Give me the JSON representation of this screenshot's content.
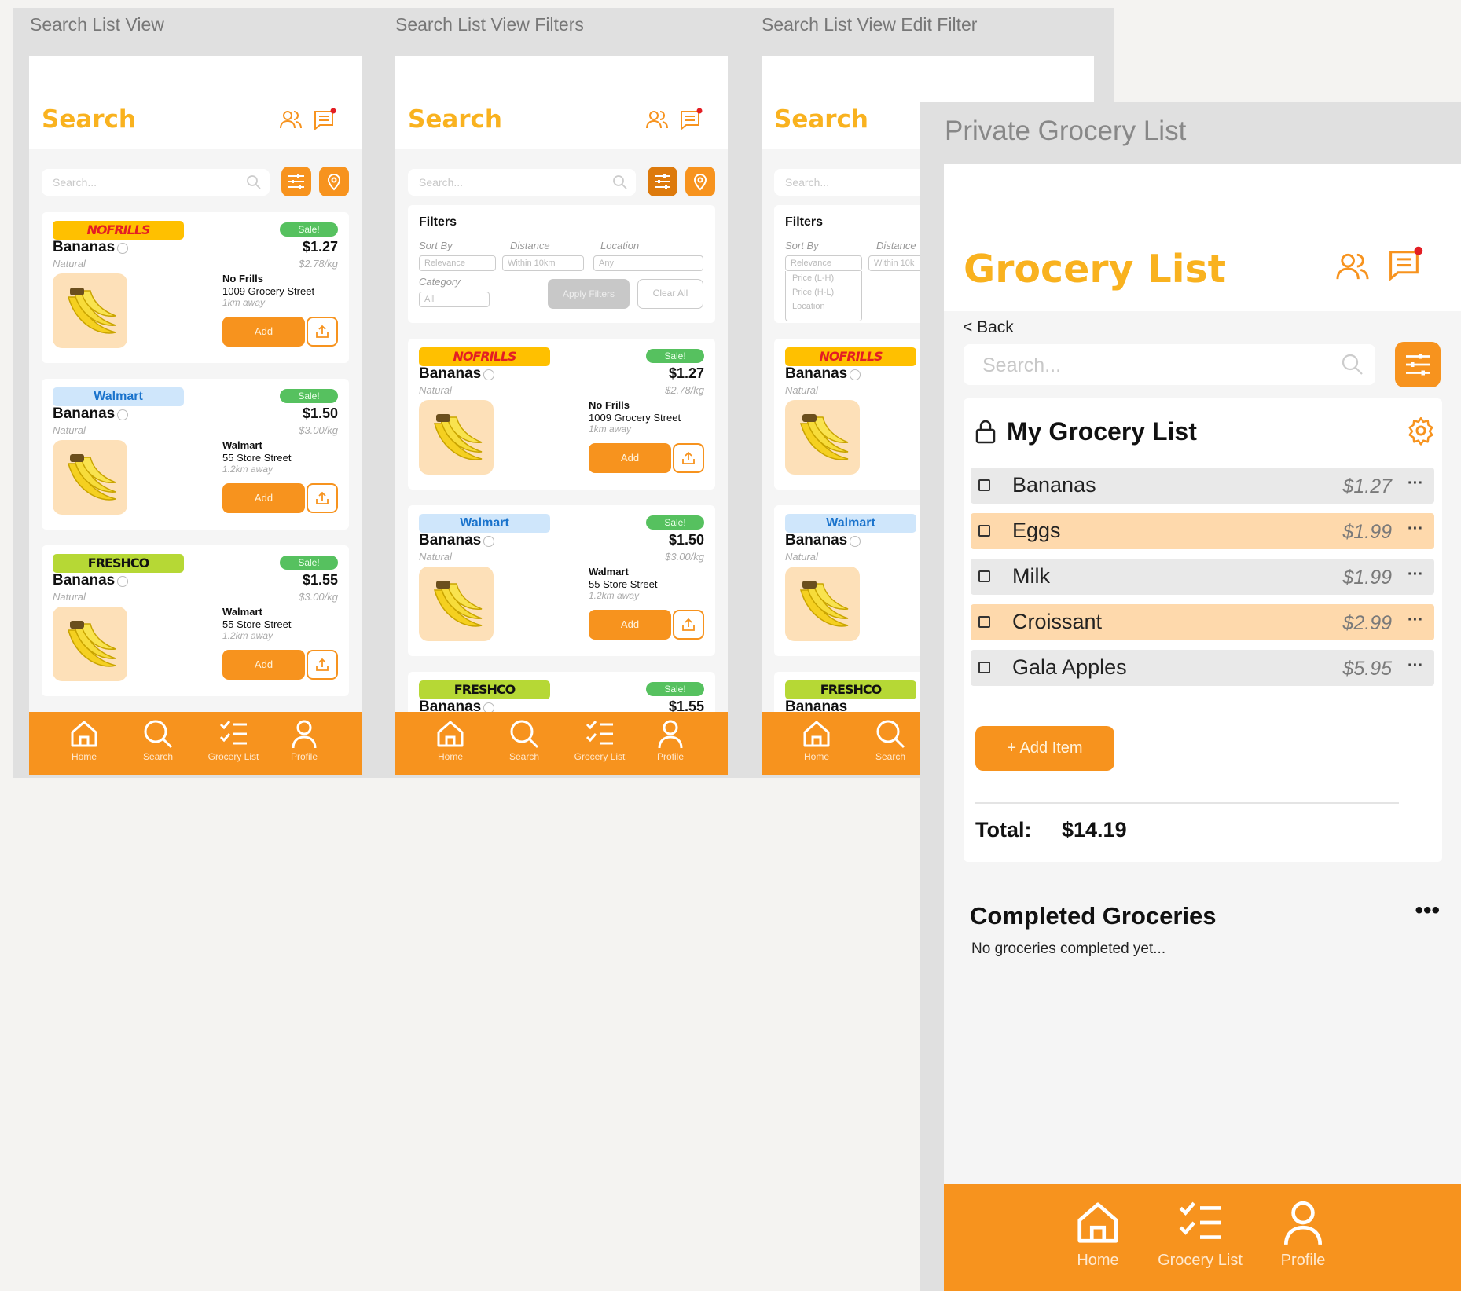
{
  "frames": {
    "list_view": "Search List View",
    "filters_view": "Search List View Filters",
    "edit_filter_view": "Search List View Edit Filter",
    "private_list": "Private Grocery List"
  },
  "search_screen": {
    "title": "Search",
    "search_placeholder": "Search...",
    "nav": [
      "Home",
      "Search",
      "Grocery List",
      "Profile"
    ]
  },
  "products": [
    {
      "logo": "NOFRILLS",
      "badge": "Sale!",
      "name": "Bananas",
      "variety": "Natural",
      "price": "$1.27",
      "unit_price": "$2.78/kg",
      "store": "No Frills",
      "address": "1009 Grocery Street",
      "distance": "1km away",
      "add": "Add"
    },
    {
      "logo": "Walmart",
      "badge": "Sale!",
      "name": "Bananas",
      "variety": "Natural",
      "price": "$1.50",
      "unit_price": "$3.00/kg",
      "store": "Walmart",
      "address": "55 Store Street",
      "distance": "1.2km away",
      "add": "Add"
    },
    {
      "logo": "FRESHCO",
      "badge": "Sale!",
      "name": "Bananas",
      "variety": "Natural",
      "price": "$1.55",
      "unit_price": "$3.00/kg",
      "store": "Walmart",
      "address": "55 Store Street",
      "distance": "1.2km away",
      "add": "Add"
    }
  ],
  "filters": {
    "title": "Filters",
    "sort_label": "Sort By",
    "distance_label": "Distance",
    "location_label": "Location",
    "category_label": "Category",
    "sort_value": "Relevance",
    "distance_value": "Within 10km",
    "distance_value_short": "Within 10k",
    "location_value": "Any",
    "category_value": "All",
    "apply": "Apply Filters",
    "clear": "Clear All",
    "sort_options": [
      "Price (L-H)",
      "Price (H-L)",
      "Location"
    ]
  },
  "grocery": {
    "title": "Grocery List",
    "back": "< Back",
    "search_placeholder": "Search...",
    "list_title": "My Grocery List",
    "items": [
      {
        "name": "Bananas",
        "price": "$1.27",
        "more": "···"
      },
      {
        "name": "Eggs",
        "price": "$1.99",
        "more": "···"
      },
      {
        "name": "Milk",
        "price": "$1.99",
        "more": "···"
      },
      {
        "name": "Croissant",
        "price": "$2.99",
        "more": "···"
      },
      {
        "name": "Gala Apples",
        "price": "$5.95",
        "more": "···"
      }
    ],
    "add_item": "+ Add Item",
    "total_label": "Total:",
    "total_value": "$14.19",
    "completed_title": "Completed Groceries",
    "completed_more": "•••",
    "completed_empty": "No groceries completed yet...",
    "nav": [
      "Home",
      "Grocery List",
      "Profile"
    ]
  },
  "colors": {
    "accent": "#f7931e",
    "title": "#f9b21f",
    "sale": "#56c15f",
    "highlight_row": "#fed9ac"
  }
}
